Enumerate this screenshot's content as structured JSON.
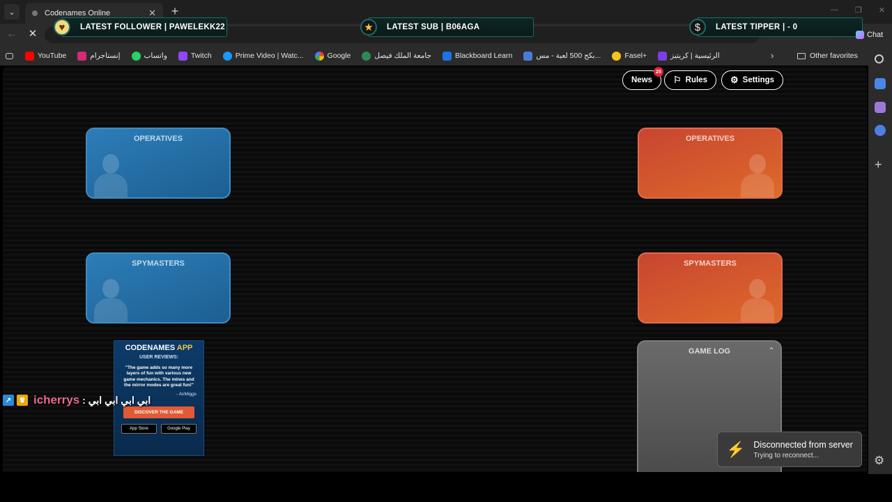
{
  "browser": {
    "tab_title": "Codenames Online",
    "chat_label": "Chat"
  },
  "overlay": {
    "follower": "LATEST FOLLOWER | PAWELEKK22",
    "sub": "LATEST SUB | B06AGA",
    "tipper": "LATEST TIPPER |  - 0"
  },
  "bookmarks": [
    {
      "label": "YouTube",
      "color": "#ff0000"
    },
    {
      "label": "إنستاجرام",
      "color": "#d62976"
    },
    {
      "label": "واتساب",
      "color": "#25d366"
    },
    {
      "label": "Twitch",
      "color": "#9146ff"
    },
    {
      "label": "Prime Video | Watc...",
      "color": "#1a98ff"
    },
    {
      "label": "Google",
      "color": "#4285f4"
    },
    {
      "label": "جامعة الملك فيصل",
      "color": "#2e8b57"
    },
    {
      "label": "Blackboard Learn",
      "color": "#1a73e8"
    },
    {
      "label": "بكج 500 لعبة - مس...",
      "color": "#4a7bd8"
    },
    {
      "label": "Fasel+",
      "color": "#f5c518"
    },
    {
      "label": "الرئيسية | كريتيز",
      "color": "#7b3fe4"
    }
  ],
  "other_favorites": "Other favorites",
  "header": {
    "news": "News",
    "news_count": "25",
    "rules": "Rules",
    "settings": "Settings"
  },
  "teams": {
    "blue_operatives": "OPERATIVES",
    "blue_spymasters": "SPYMASTERS",
    "red_operatives": "OPERATIVES",
    "red_spymasters": "SPYMASTERS"
  },
  "game_log": "GAME LOG",
  "app_ad": {
    "title_a": "CODENAMES ",
    "title_b": "APP",
    "subtitle": "USER REVIEWS:",
    "quote": "\"The game adds so many more layers of fun with various new game mechanics. The mines and the mirror modes are great fun!\"",
    "author": "- AirMiggs",
    "button": "DISCOVER THE GAME",
    "store_1": "App Store",
    "store_2": "Google Play"
  },
  "chat": {
    "user": "icherrys",
    "message": ": ابي ابي ابي ابي"
  },
  "toast": {
    "title": "Disconnected from server",
    "subtitle": "Trying to reconnect..."
  },
  "colors": {
    "blue_team": "#2d7db8",
    "red_team": "#c84531",
    "accent_teal": "#1d6b68"
  }
}
